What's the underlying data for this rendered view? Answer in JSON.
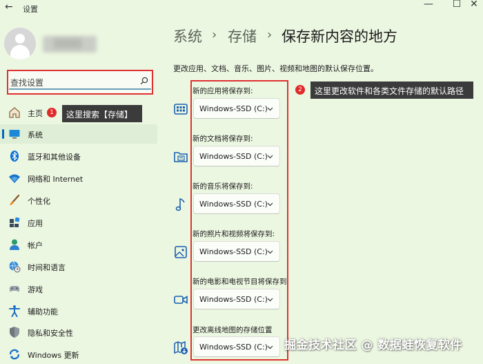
{
  "window": {
    "back": "←",
    "title": "设置",
    "controls": [
      "—",
      "☐",
      "✕"
    ]
  },
  "search": {
    "placeholder": "查找设置"
  },
  "sidebar": {
    "items": [
      {
        "label": "主页",
        "icon": "home-icon"
      },
      {
        "label": "系统",
        "icon": "system-icon"
      },
      {
        "label": "蓝牙和其他设备",
        "icon": "bluetooth-icon"
      },
      {
        "label": "网络和 Internet",
        "icon": "wifi-icon"
      },
      {
        "label": "个性化",
        "icon": "brush-icon"
      },
      {
        "label": "应用",
        "icon": "apps-icon"
      },
      {
        "label": "帐户",
        "icon": "account-icon"
      },
      {
        "label": "时间和语言",
        "icon": "globe-clock-icon"
      },
      {
        "label": "游戏",
        "icon": "gamepad-icon"
      },
      {
        "label": "辅助功能",
        "icon": "accessibility-icon"
      },
      {
        "label": "隐私和安全性",
        "icon": "shield-icon"
      },
      {
        "label": "Windows 更新",
        "icon": "update-icon"
      }
    ]
  },
  "annotations": {
    "search_callout": "这里搜索【存储】",
    "search_badge": "1",
    "main_callout": "这里更改软件和各类文件存储的默认路径",
    "main_badge": "2"
  },
  "breadcrumb": {
    "items": [
      "系统",
      "存储",
      "保存新内容的地方"
    ],
    "separator": "›"
  },
  "description": "更改应用、文档、音乐、图片、视频和地图的默认保存位置。",
  "settings": [
    {
      "label": "新的应用将保存到:",
      "value": "Windows-SSD (C:)",
      "icon": "app-window-icon"
    },
    {
      "label": "新的文档将保存到:",
      "value": "Windows-SSD (C:)",
      "icon": "folder-document-icon"
    },
    {
      "label": "新的音乐将保存到:",
      "value": "Windows-SSD (C:)",
      "icon": "music-note-icon"
    },
    {
      "label": "新的照片和视频将保存到:",
      "value": "Windows-SSD (C:)",
      "icon": "picture-icon"
    },
    {
      "label": "新的电影和电视节目将保存到:",
      "value": "Windows-SSD (C:)",
      "icon": "video-camera-icon"
    },
    {
      "label": "更改离线地图的存储位置",
      "value": "Windows-SSD (C:)",
      "icon": "map-download-icon"
    }
  ],
  "watermark": "掘金技术社区 @ 数据蛙恢复软件",
  "colors": {
    "background": "#ecf7e2",
    "accent": "#0067c0",
    "annotation_red": "#e03030"
  }
}
